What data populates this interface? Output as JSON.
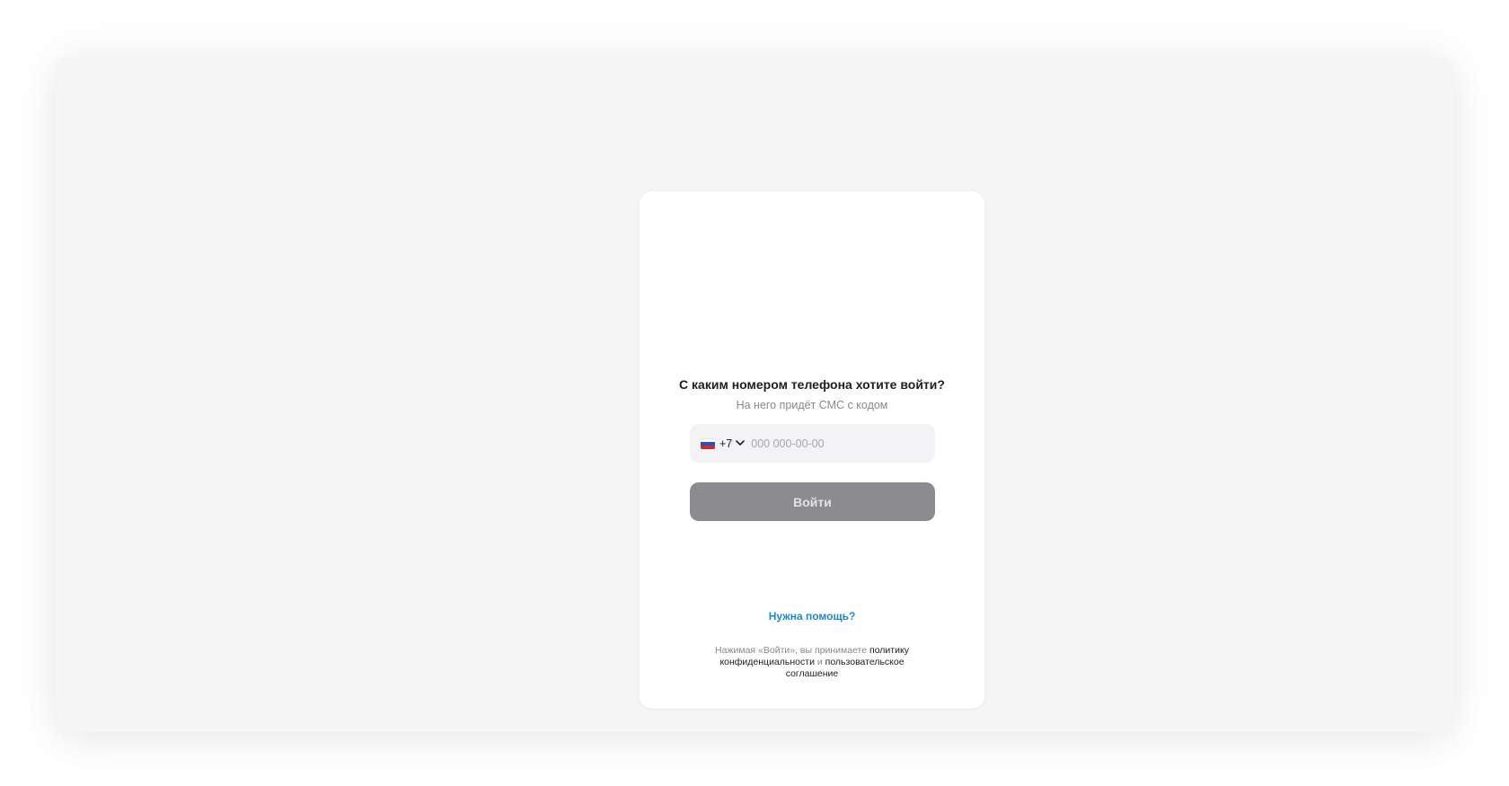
{
  "login": {
    "title": "С каким номером телефона хотите войти?",
    "subtitle": "На него придёт СМС с кодом",
    "phone": {
      "country_code": "+7",
      "value": "",
      "placeholder": "000 000-00-00"
    },
    "submit_label": "Войти",
    "help_link": "Нужна помощь?",
    "legal": {
      "prefix": "Нажимая «Войти», вы принимаете ",
      "privacy_link": "политику конфиденциальности",
      "conjunction": " и ",
      "terms_link": "пользовательское соглашение"
    }
  },
  "colors": {
    "window_bg": "#f5f5f6",
    "card_bg": "#ffffff",
    "input_bg": "#f3f2f4",
    "button_disabled_bg": "#8c8c90",
    "button_disabled_text": "#e2e2e4",
    "link": "#1a8ad0"
  },
  "icons": {
    "flag": "russia-flag-icon",
    "chevron": "chevron-down-icon"
  }
}
